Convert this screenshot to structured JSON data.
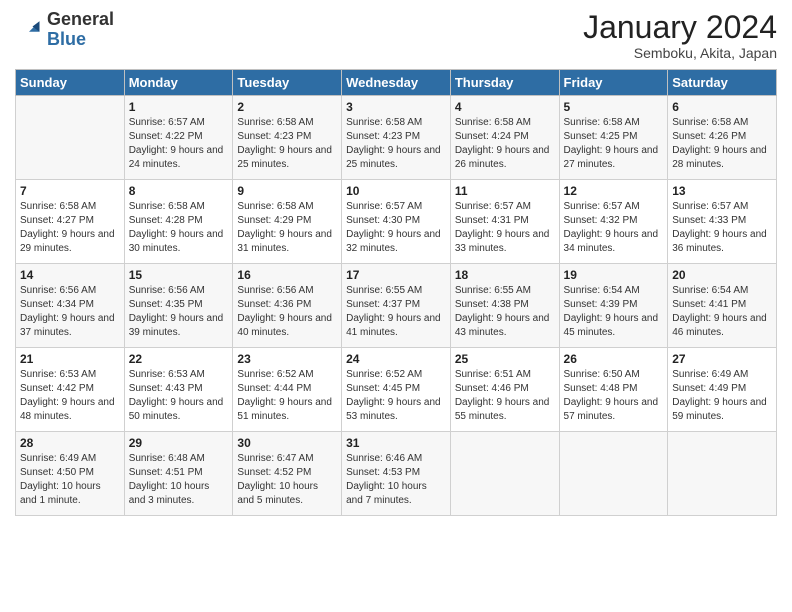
{
  "logo": {
    "general": "General",
    "blue": "Blue"
  },
  "header": {
    "title": "January 2024",
    "subtitle": "Semboku, Akita, Japan"
  },
  "weekdays": [
    "Sunday",
    "Monday",
    "Tuesday",
    "Wednesday",
    "Thursday",
    "Friday",
    "Saturday"
  ],
  "weeks": [
    [
      {
        "day": "",
        "sunrise": "",
        "sunset": "",
        "daylight": ""
      },
      {
        "day": "1",
        "sunrise": "Sunrise: 6:57 AM",
        "sunset": "Sunset: 4:22 PM",
        "daylight": "Daylight: 9 hours and 24 minutes."
      },
      {
        "day": "2",
        "sunrise": "Sunrise: 6:58 AM",
        "sunset": "Sunset: 4:23 PM",
        "daylight": "Daylight: 9 hours and 25 minutes."
      },
      {
        "day": "3",
        "sunrise": "Sunrise: 6:58 AM",
        "sunset": "Sunset: 4:23 PM",
        "daylight": "Daylight: 9 hours and 25 minutes."
      },
      {
        "day": "4",
        "sunrise": "Sunrise: 6:58 AM",
        "sunset": "Sunset: 4:24 PM",
        "daylight": "Daylight: 9 hours and 26 minutes."
      },
      {
        "day": "5",
        "sunrise": "Sunrise: 6:58 AM",
        "sunset": "Sunset: 4:25 PM",
        "daylight": "Daylight: 9 hours and 27 minutes."
      },
      {
        "day": "6",
        "sunrise": "Sunrise: 6:58 AM",
        "sunset": "Sunset: 4:26 PM",
        "daylight": "Daylight: 9 hours and 28 minutes."
      }
    ],
    [
      {
        "day": "7",
        "sunrise": "Sunrise: 6:58 AM",
        "sunset": "Sunset: 4:27 PM",
        "daylight": "Daylight: 9 hours and 29 minutes."
      },
      {
        "day": "8",
        "sunrise": "Sunrise: 6:58 AM",
        "sunset": "Sunset: 4:28 PM",
        "daylight": "Daylight: 9 hours and 30 minutes."
      },
      {
        "day": "9",
        "sunrise": "Sunrise: 6:58 AM",
        "sunset": "Sunset: 4:29 PM",
        "daylight": "Daylight: 9 hours and 31 minutes."
      },
      {
        "day": "10",
        "sunrise": "Sunrise: 6:57 AM",
        "sunset": "Sunset: 4:30 PM",
        "daylight": "Daylight: 9 hours and 32 minutes."
      },
      {
        "day": "11",
        "sunrise": "Sunrise: 6:57 AM",
        "sunset": "Sunset: 4:31 PM",
        "daylight": "Daylight: 9 hours and 33 minutes."
      },
      {
        "day": "12",
        "sunrise": "Sunrise: 6:57 AM",
        "sunset": "Sunset: 4:32 PM",
        "daylight": "Daylight: 9 hours and 34 minutes."
      },
      {
        "day": "13",
        "sunrise": "Sunrise: 6:57 AM",
        "sunset": "Sunset: 4:33 PM",
        "daylight": "Daylight: 9 hours and 36 minutes."
      }
    ],
    [
      {
        "day": "14",
        "sunrise": "Sunrise: 6:56 AM",
        "sunset": "Sunset: 4:34 PM",
        "daylight": "Daylight: 9 hours and 37 minutes."
      },
      {
        "day": "15",
        "sunrise": "Sunrise: 6:56 AM",
        "sunset": "Sunset: 4:35 PM",
        "daylight": "Daylight: 9 hours and 39 minutes."
      },
      {
        "day": "16",
        "sunrise": "Sunrise: 6:56 AM",
        "sunset": "Sunset: 4:36 PM",
        "daylight": "Daylight: 9 hours and 40 minutes."
      },
      {
        "day": "17",
        "sunrise": "Sunrise: 6:55 AM",
        "sunset": "Sunset: 4:37 PM",
        "daylight": "Daylight: 9 hours and 41 minutes."
      },
      {
        "day": "18",
        "sunrise": "Sunrise: 6:55 AM",
        "sunset": "Sunset: 4:38 PM",
        "daylight": "Daylight: 9 hours and 43 minutes."
      },
      {
        "day": "19",
        "sunrise": "Sunrise: 6:54 AM",
        "sunset": "Sunset: 4:39 PM",
        "daylight": "Daylight: 9 hours and 45 minutes."
      },
      {
        "day": "20",
        "sunrise": "Sunrise: 6:54 AM",
        "sunset": "Sunset: 4:41 PM",
        "daylight": "Daylight: 9 hours and 46 minutes."
      }
    ],
    [
      {
        "day": "21",
        "sunrise": "Sunrise: 6:53 AM",
        "sunset": "Sunset: 4:42 PM",
        "daylight": "Daylight: 9 hours and 48 minutes."
      },
      {
        "day": "22",
        "sunrise": "Sunrise: 6:53 AM",
        "sunset": "Sunset: 4:43 PM",
        "daylight": "Daylight: 9 hours and 50 minutes."
      },
      {
        "day": "23",
        "sunrise": "Sunrise: 6:52 AM",
        "sunset": "Sunset: 4:44 PM",
        "daylight": "Daylight: 9 hours and 51 minutes."
      },
      {
        "day": "24",
        "sunrise": "Sunrise: 6:52 AM",
        "sunset": "Sunset: 4:45 PM",
        "daylight": "Daylight: 9 hours and 53 minutes."
      },
      {
        "day": "25",
        "sunrise": "Sunrise: 6:51 AM",
        "sunset": "Sunset: 4:46 PM",
        "daylight": "Daylight: 9 hours and 55 minutes."
      },
      {
        "day": "26",
        "sunrise": "Sunrise: 6:50 AM",
        "sunset": "Sunset: 4:48 PM",
        "daylight": "Daylight: 9 hours and 57 minutes."
      },
      {
        "day": "27",
        "sunrise": "Sunrise: 6:49 AM",
        "sunset": "Sunset: 4:49 PM",
        "daylight": "Daylight: 9 hours and 59 minutes."
      }
    ],
    [
      {
        "day": "28",
        "sunrise": "Sunrise: 6:49 AM",
        "sunset": "Sunset: 4:50 PM",
        "daylight": "Daylight: 10 hours and 1 minute."
      },
      {
        "day": "29",
        "sunrise": "Sunrise: 6:48 AM",
        "sunset": "Sunset: 4:51 PM",
        "daylight": "Daylight: 10 hours and 3 minutes."
      },
      {
        "day": "30",
        "sunrise": "Sunrise: 6:47 AM",
        "sunset": "Sunset: 4:52 PM",
        "daylight": "Daylight: 10 hours and 5 minutes."
      },
      {
        "day": "31",
        "sunrise": "Sunrise: 6:46 AM",
        "sunset": "Sunset: 4:53 PM",
        "daylight": "Daylight: 10 hours and 7 minutes."
      },
      {
        "day": "",
        "sunrise": "",
        "sunset": "",
        "daylight": ""
      },
      {
        "day": "",
        "sunrise": "",
        "sunset": "",
        "daylight": ""
      },
      {
        "day": "",
        "sunrise": "",
        "sunset": "",
        "daylight": ""
      }
    ]
  ]
}
